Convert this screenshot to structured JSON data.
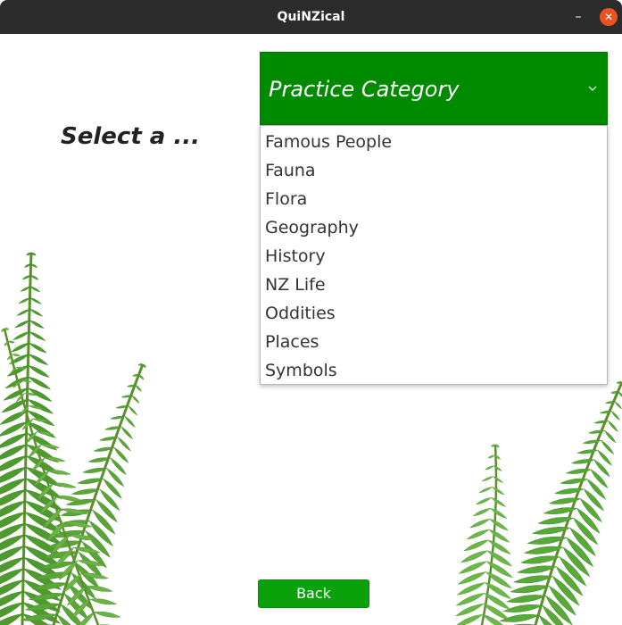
{
  "window": {
    "title": "QuiNZical",
    "minimize_glyph": "–",
    "close_glyph": "✕"
  },
  "page": {
    "prompt": "Select a ...",
    "combo": {
      "selected": "Practice Category",
      "icon": "chevron-down-icon"
    },
    "options": [
      "Famous People",
      "Fauna",
      "Flora",
      "Geography",
      "History",
      "NZ Life",
      "Oddities",
      "Places",
      "Symbols"
    ],
    "back_label": "Back"
  },
  "colors": {
    "titlebar": "#2c2c2c",
    "combo_green": "#008a00",
    "button_green": "#0aa10a",
    "close_orange": "#e95420",
    "fern_green": "#4f9a2e"
  }
}
